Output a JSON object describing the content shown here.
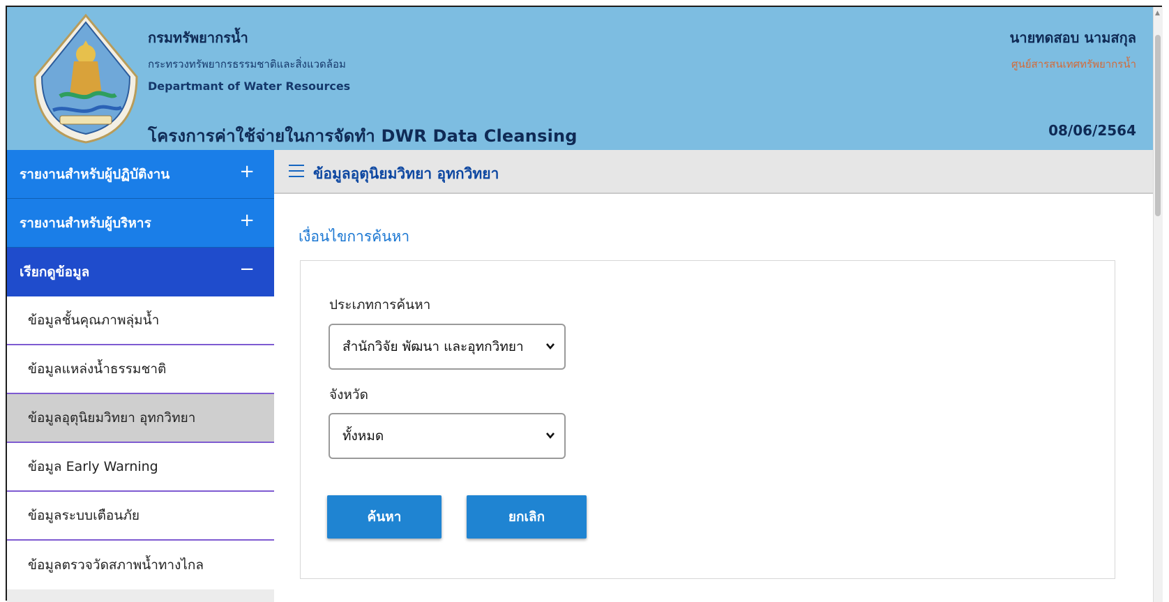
{
  "header": {
    "org_name_th": "กรมทรัพยากรน้ำ",
    "ministry_th": "กระทรวงทรัพยากรธรรมชาติและสิ่งแวดล้อม",
    "org_name_en": "Departmant of Water Resources",
    "project_title": "โครงการค่าใช้จ่ายในการจัดทำ DWR Data Cleansing",
    "user_name": "นายทดสอบ นามสกุล",
    "user_unit": "ศูนย์สารสนเทศทรัพยากรน้ำ",
    "date": "08/06/2564"
  },
  "sidebar": {
    "groups": [
      {
        "label": "รายงานสำหรับผู้ปฏิบัติงาน",
        "toggle": "+"
      },
      {
        "label": "รายงานสำหรับผู้บริหาร",
        "toggle": "+"
      },
      {
        "label": "เรียกดูข้อมูล",
        "toggle": "−"
      }
    ],
    "items": [
      {
        "label": "ข้อมูลชั้นคุณภาพลุ่มน้ำ"
      },
      {
        "label": "ข้อมูลแหล่งน้ำธรรมชาติ"
      },
      {
        "label": "ข้อมูลอุตุนิยมวิทยา อุทกวิทยา"
      },
      {
        "label": "ข้อมูล Early Warning"
      },
      {
        "label": "ข้อมูลระบบเตือนภัย"
      },
      {
        "label": "ข้อมูลตรวจวัดสภาพน้ำทางไกล"
      }
    ],
    "active_index": 2
  },
  "main": {
    "page_title": "ข้อมูลอุตุนิยมวิทยา อุทกวิทยา",
    "section_title": "เงื่อนไขการค้นหา",
    "search_type": {
      "label": "ประเภทการค้นหา",
      "selected": "สำนักวิจัย พัฒนา และอุทกวิทยา"
    },
    "province": {
      "label": "จังหวัด",
      "selected": "ทั้งหมด"
    },
    "search_button": "ค้นหา",
    "cancel_button": "ยกเลิก"
  },
  "colors": {
    "header_bg": "#7dbde1",
    "sidebar_group": "#1a7ee8",
    "sidebar_group_open": "#1f4ccc",
    "button": "#1f84d2",
    "divider": "#7e5ad1"
  }
}
